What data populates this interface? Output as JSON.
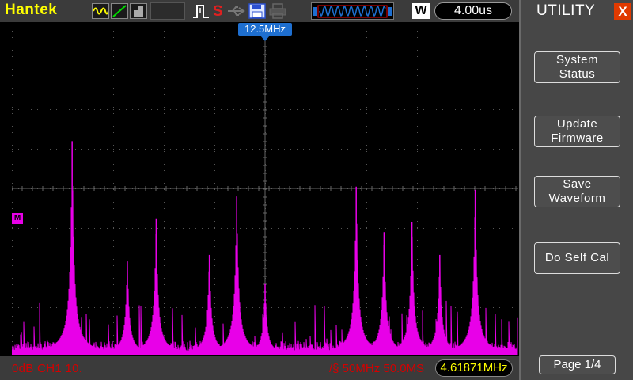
{
  "header": {
    "brand": "Hantek",
    "w_badge": "W",
    "timebase": "4.00us"
  },
  "icons": [
    "sine-wave-icon",
    "ramp-icon",
    "fill-icon",
    "trigger-pulse-icon",
    "save-s-icon",
    "usb-icon",
    "floppy-icon",
    "printer-icon",
    "waveform-strip-icon"
  ],
  "screen": {
    "trigger_freq_label": "12.5MHz",
    "channel_marker": "M"
  },
  "bottom": {
    "channel_info": "0dB  CH1 10.",
    "fft_info": "/§ 50MHz 50.0MS",
    "freq_readout": "4.61871MHz"
  },
  "menu": {
    "title": "UTILITY",
    "close": "X",
    "buttons": [
      {
        "line1": "System",
        "line2": "Status"
      },
      {
        "line1": "Update",
        "line2": "Firmware"
      },
      {
        "line1": "Save",
        "line2": "Waveform"
      },
      {
        "line1": "Do Self Cal",
        "line2": ""
      }
    ],
    "page": "Page 1/4"
  },
  "colors": {
    "trace": "#e800e8",
    "accent_yellow": "#ffff00",
    "info_red": "#d40000",
    "marker_blue": "#1e6fd0"
  },
  "chart_data": {
    "type": "line",
    "series": [
      {
        "peaks": [
          {
            "x": 0.119,
            "amp": 0.66
          },
          {
            "x": 0.228,
            "amp": 0.29
          },
          {
            "x": 0.285,
            "amp": 0.42
          },
          {
            "x": 0.39,
            "amp": 0.31
          },
          {
            "x": 0.444,
            "amp": 0.49
          },
          {
            "x": 0.5,
            "amp": 0.22
          },
          {
            "x": 0.68,
            "amp": 0.52
          },
          {
            "x": 0.735,
            "amp": 0.38
          },
          {
            "x": 0.79,
            "amp": 0.41
          },
          {
            "x": 0.845,
            "amp": 0.31
          },
          {
            "x": 0.915,
            "amp": 0.51
          }
        ]
      }
    ]
  }
}
